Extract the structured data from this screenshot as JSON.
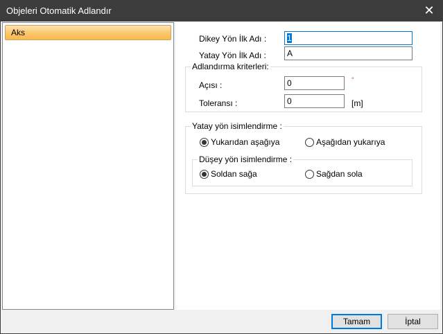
{
  "window": {
    "title": "Objeleri Otomatik Adlandır",
    "close_icon": "close-icon"
  },
  "list": {
    "items": [
      {
        "label": "Aks",
        "selected": true
      }
    ]
  },
  "form": {
    "dikey_label": "Dikey Yön İlk Adı :",
    "dikey_value": "1",
    "yatay_label": "Yatay Yön İlk Adı :",
    "yatay_value": "A",
    "criteria": {
      "legend": "Adlandırma kriterleri:",
      "angle_label": "Açısı :",
      "angle_value": "0",
      "angle_unit": "°",
      "tol_label": "Toleransı :",
      "tol_value": "0",
      "tol_unit": "[m]"
    },
    "horizontal": {
      "legend": "Yatay yön isimlendirme :",
      "options": [
        {
          "label": "Yukarıdan aşağıya",
          "checked": true
        },
        {
          "label": "Aşağıdan yukarıya",
          "checked": false
        }
      ]
    },
    "vertical": {
      "legend": "Düşey yön isimlendirme :",
      "options": [
        {
          "label": "Soldan sağa",
          "checked": true
        },
        {
          "label": "Sağdan sola",
          "checked": false
        }
      ]
    }
  },
  "buttons": {
    "ok": "Tamam",
    "cancel": "İptal"
  }
}
